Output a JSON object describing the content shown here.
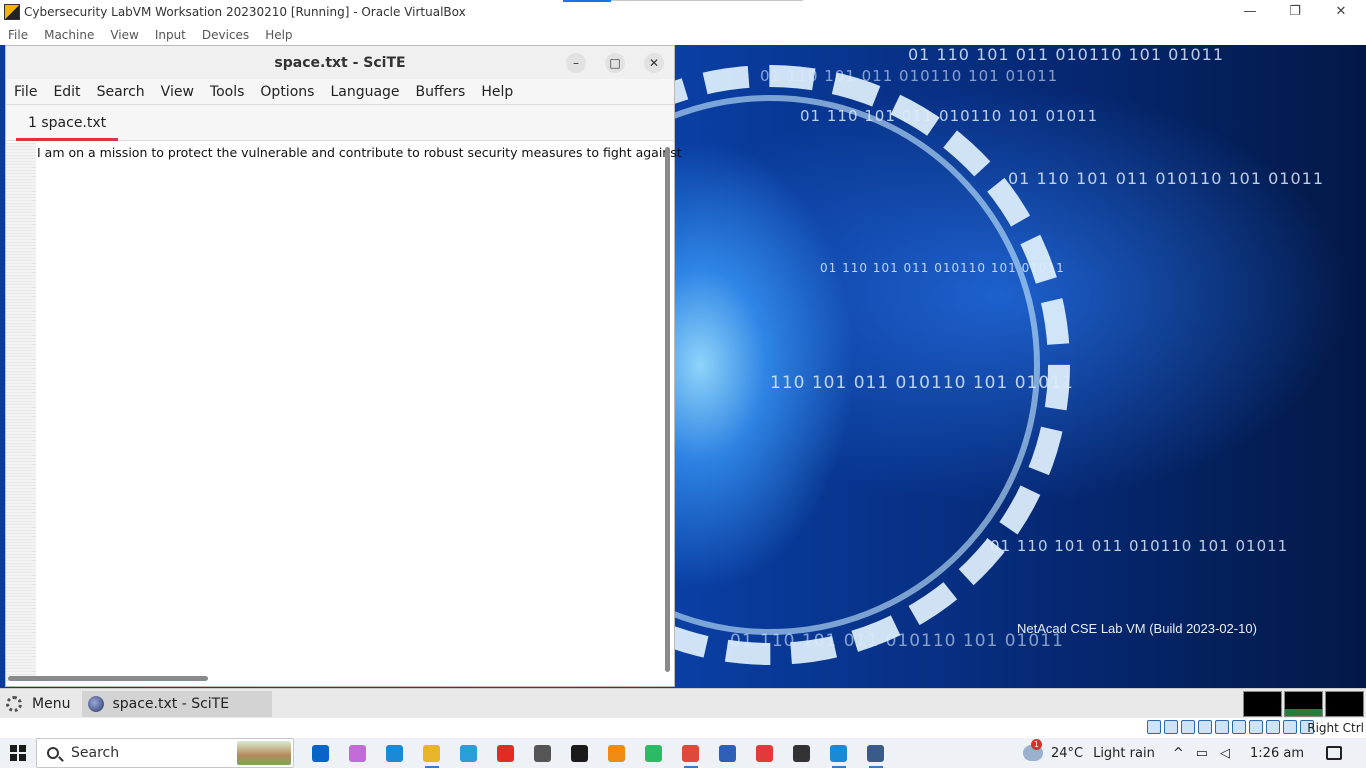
{
  "vbox": {
    "title": "Cybersecurity LabVM Worksation 20230210 [Running] - Oracle VirtualBox",
    "menu": [
      "File",
      "Machine",
      "View",
      "Input",
      "Devices",
      "Help"
    ],
    "controls": {
      "minimize": "—",
      "restore": "❐",
      "close": "✕"
    }
  },
  "desktop": {
    "binary_lines": [
      "01 110 101 011 010110 101 01011",
      "01 110 101 011 010110 101 01011",
      "01 110 101 011 010110 101 01011",
      "01 110 101 011 010110 101 01011",
      "01 110 101 011 010110 101 01011",
      "110 101 011 010110 101 01011",
      "01 110 101 011 010110 101 01011",
      "01 110 101 011 010110 101 01011"
    ],
    "vm_label": "NetAcad CSE Lab VM (Build 2023-02-10)"
  },
  "scite": {
    "title": "space.txt - SciTE",
    "menu": [
      "File",
      "Edit",
      "Search",
      "View",
      "Tools",
      "Options",
      "Language",
      "Buffers",
      "Help"
    ],
    "tab": "1 space.txt",
    "content_line": "I am on a mission to protect the vulnerable and contribute to robust security measures to fight against",
    "buttons": {
      "minimize": "–",
      "maximize": "□",
      "close": "✕"
    }
  },
  "guest_panel": {
    "menu_label": "Menu",
    "task_label": "space.txt - SciTE"
  },
  "vbox_status": {
    "host_key": "Right Ctrl"
  },
  "taskbar": {
    "search_label": "Search",
    "apps": [
      {
        "name": "outlook-icon",
        "color": "#0a64c8"
      },
      {
        "name": "copilot-icon",
        "color": "#c26ad8"
      },
      {
        "name": "edge-icon",
        "color": "#1a8ad6"
      },
      {
        "name": "file-explorer-icon",
        "color": "#e8b429"
      },
      {
        "name": "telegram-icon",
        "color": "#2a9ed8"
      },
      {
        "name": "youtube-icon",
        "color": "#e22b22"
      },
      {
        "name": "cisco-icon",
        "color": "#555555"
      },
      {
        "name": "tradingview-icon",
        "color": "#1a1a1a"
      },
      {
        "name": "vlc-icon",
        "color": "#f08a12"
      },
      {
        "name": "play-store-icon",
        "color": "#2abb64"
      },
      {
        "name": "chrome-icon",
        "color": "#de4a3a"
      },
      {
        "name": "word-icon",
        "color": "#2b5fb8"
      },
      {
        "name": "wps-icon",
        "color": "#e03a3a"
      },
      {
        "name": "terminal-icon",
        "color": "#333333"
      },
      {
        "name": "vscode-icon",
        "color": "#1a8ad6"
      },
      {
        "name": "virtualbox-icon",
        "color": "#3a5a8a"
      }
    ],
    "weather_temp": "24°C",
    "weather_text": "Light rain",
    "weather_badge": "1",
    "time": "1:26 am"
  }
}
